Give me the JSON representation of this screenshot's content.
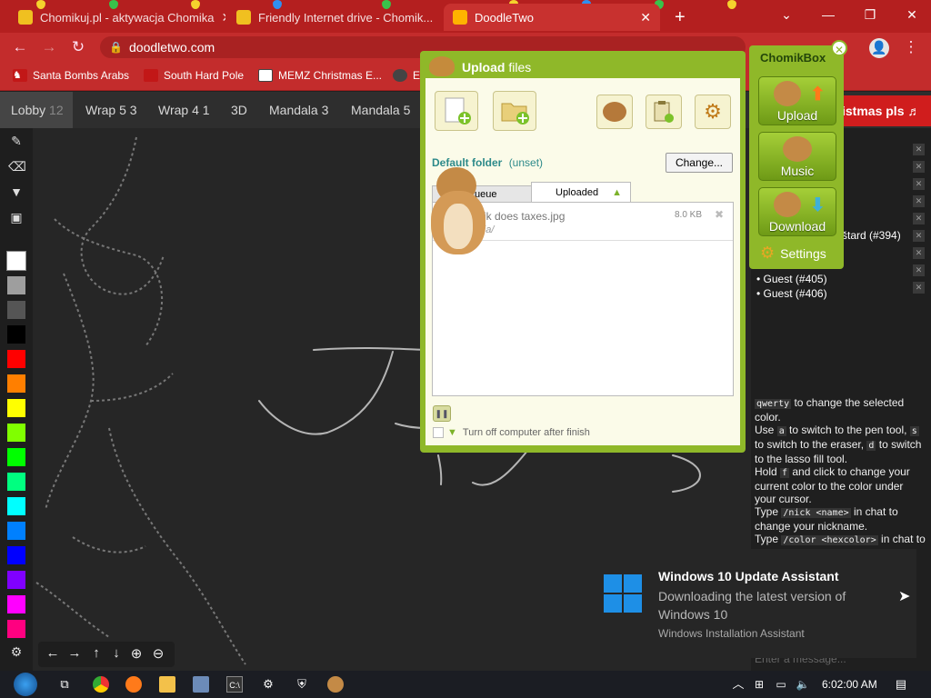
{
  "browser": {
    "tabs": [
      {
        "title": "Chomikuj.pl - aktywacja Chomika",
        "favicon_color": "#f0c020"
      },
      {
        "title": "Friendly Internet drive - Chomik...",
        "favicon_color": "#f0c020"
      },
      {
        "title": "DoodleTwo",
        "favicon_color": "#ffb300"
      }
    ],
    "new_tab": "+",
    "window_buttons": [
      "⌄",
      "—",
      "❐",
      "✕"
    ],
    "url": "doodletwo.com",
    "bookmarks": [
      "Santa Bombs Arabs",
      "South Hard Pole",
      "MEMZ Christmas E...",
      "E"
    ]
  },
  "doodle": {
    "tabs": [
      {
        "name": "Lobby",
        "count": "12"
      },
      {
        "name": "Wrap 5",
        "count": "3"
      },
      {
        "name": "Wrap 4",
        "count": "1"
      },
      {
        "name": "3D",
        "count": ""
      },
      {
        "name": "Mandala",
        "count": "3"
      },
      {
        "name": "Mandala 5",
        "count": ""
      }
    ],
    "banner": "istmas pls ♬",
    "palette": [
      "#ffffff",
      "#9e9e9e",
      "#555555",
      "#000000",
      "#ff0000",
      "#ff7f00",
      "#ffff00",
      "#80ff00",
      "#00ff00",
      "#00ff80",
      "#00ffff",
      "#0080ff",
      "#0000ff",
      "#8000ff",
      "#ff00ff",
      "#ff0080"
    ],
    "users": [
      "štard (#394)",
      "Guest (#405)",
      "Guest (#406)"
    ],
    "help": {
      "l1a": "qwerty",
      "l1b": " to change the selected color.",
      "l2a": "Use ",
      "l2b": "a",
      "l2c": " to switch to the pen tool, ",
      "l2d": "s",
      "l2e": " to switch to the eraser, ",
      "l2f": "d",
      "l2g": " to switch to the lasso fill tool.",
      "l3a": "Hold ",
      "l3b": "f",
      "l3c": " and click to change your current color to the color under your cursor.",
      "l4a": "Type ",
      "l4b": "/nick <name>",
      "l4c": " in chat to change your nickname.",
      "l5a": "Type ",
      "l5b": "/color <hexcolor>",
      "l5c": " in chat to change to a specific color."
    },
    "chat_placeholder": "Enter a message..."
  },
  "upload_window": {
    "title_bold": "Upload",
    "title_rest": " files",
    "default_folder_label": "Default folder",
    "default_folder_value": "(unset)",
    "change_button": "Change...",
    "tab_queue": "ueue",
    "tab_uploaded": "Uploaded",
    "file_name": "mik does taxes.jpg",
    "file_size": "8.0 KB",
    "file_path": "eria/",
    "shutdown_label": "Turn off computer after finish"
  },
  "chomikbox": {
    "title": "ChomikBox",
    "upload": "Upload",
    "music": "Music",
    "download": "Download",
    "settings": "Settings"
  },
  "notification": {
    "title": "Windows 10 Update Assistant",
    "body": "Downloading the latest version of Windows 10",
    "source": "Windows Installation Assistant"
  },
  "taskbar": {
    "time": "6:02:00 AM"
  }
}
